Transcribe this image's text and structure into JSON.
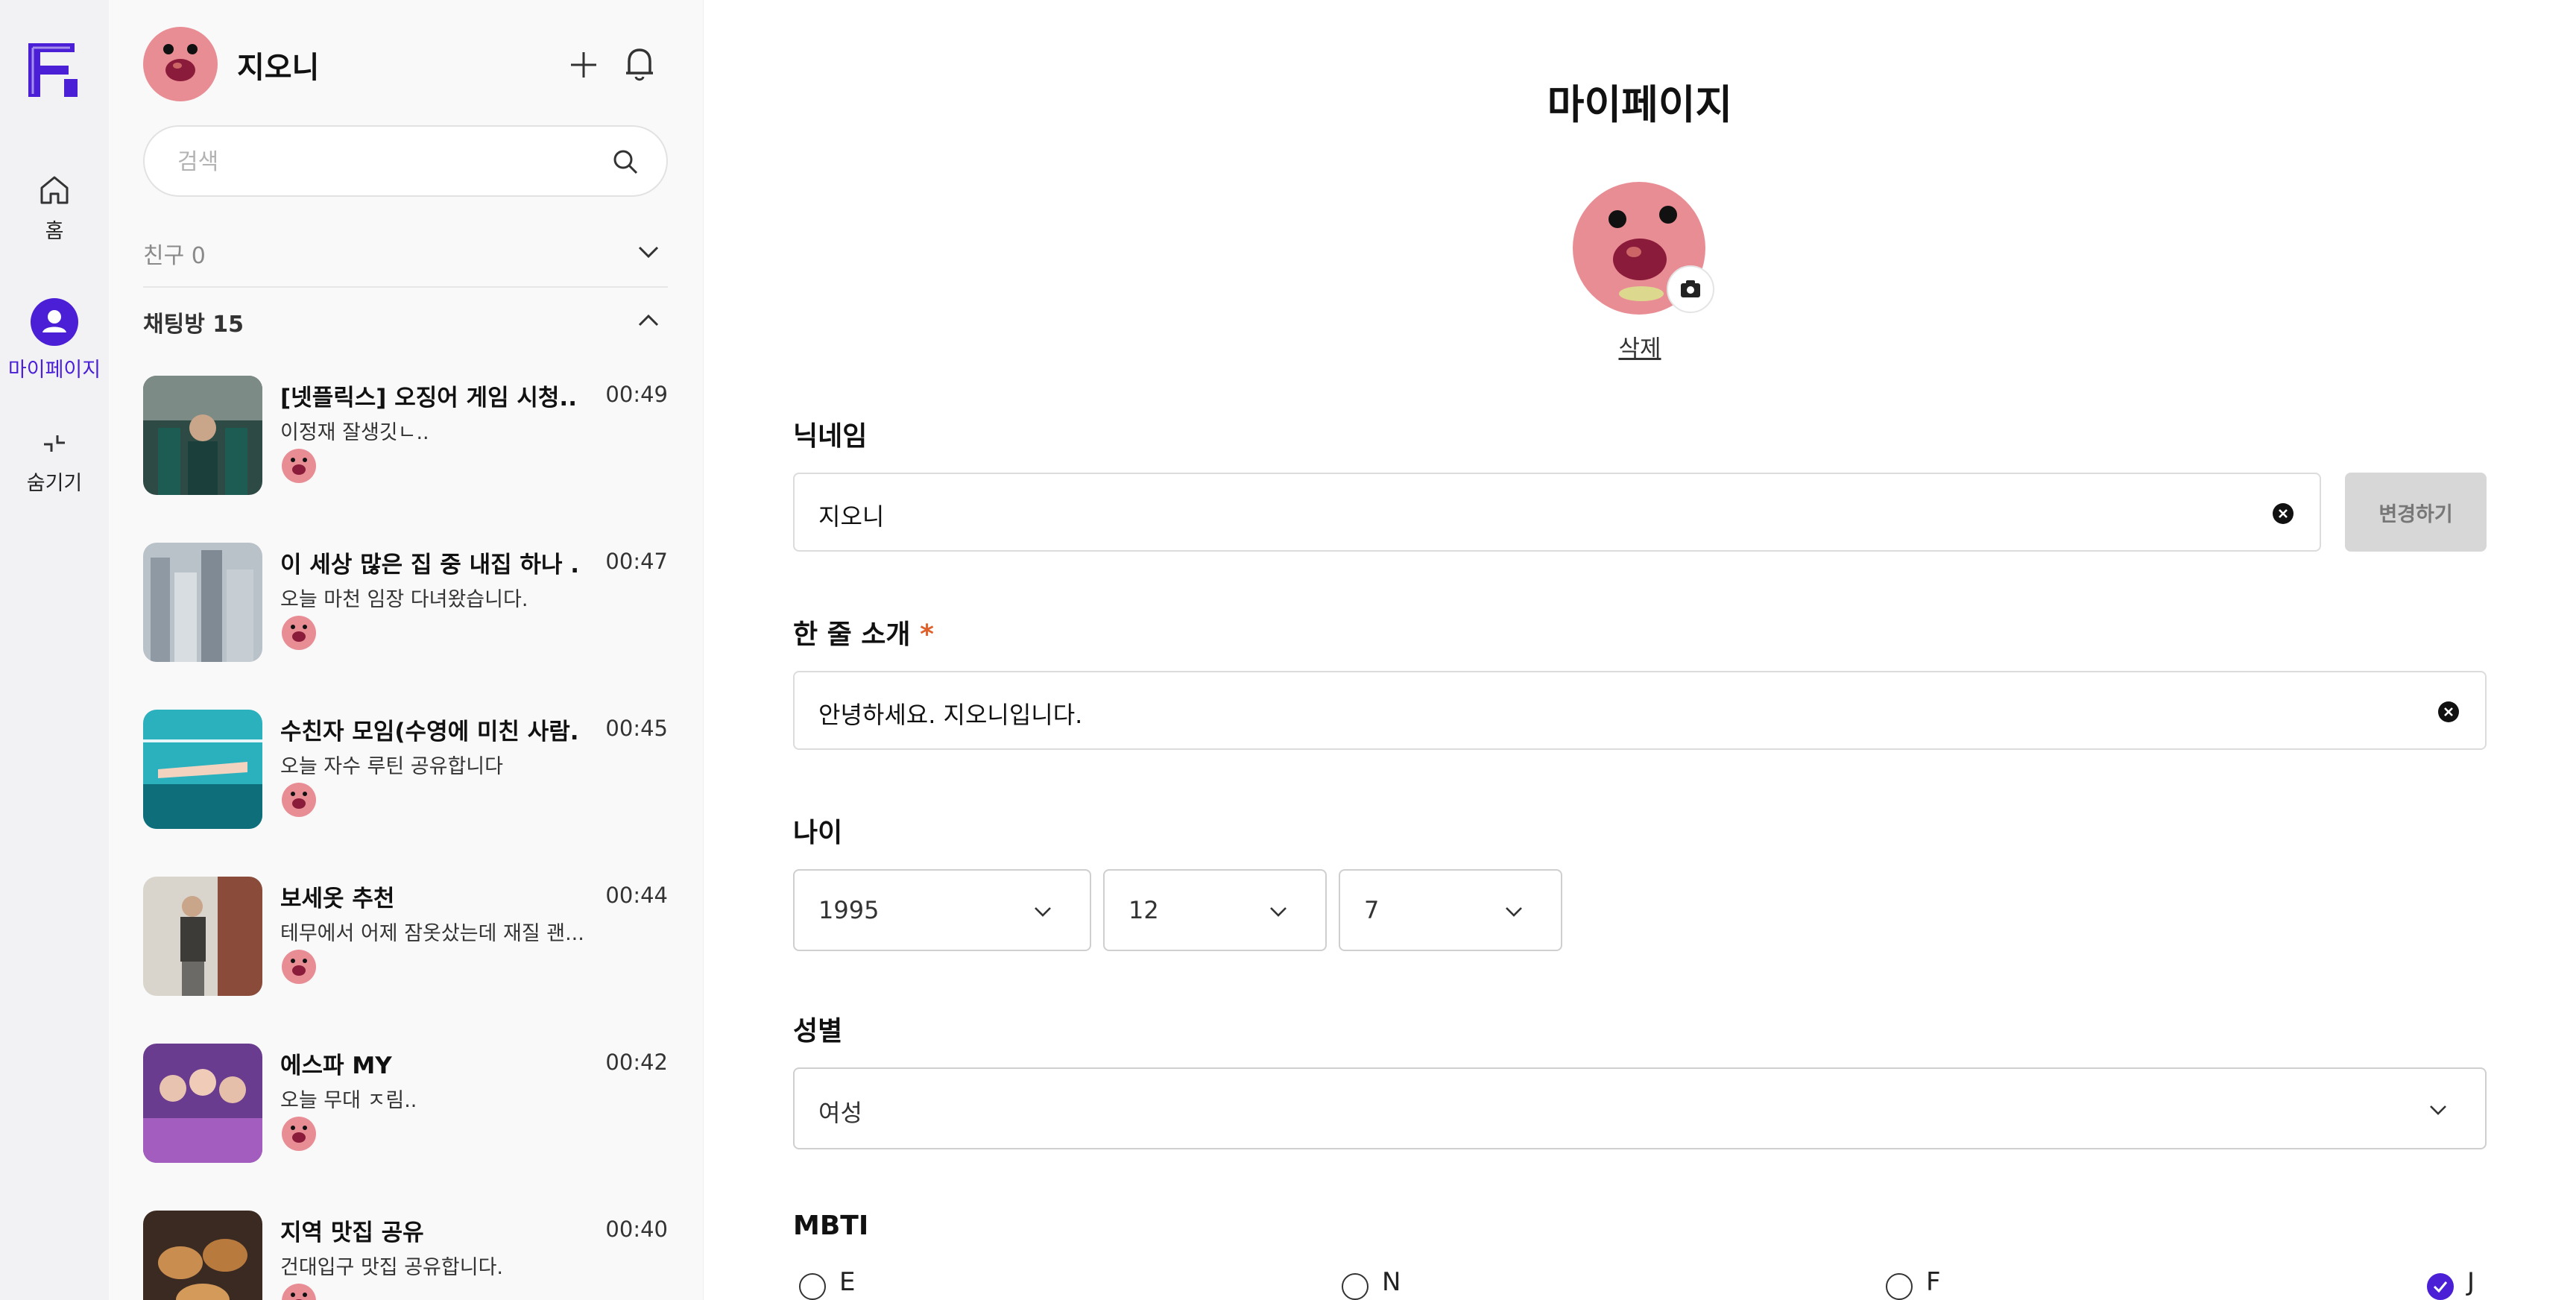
{
  "rail": {
    "items": [
      {
        "label": "홈",
        "icon": "home-icon"
      },
      {
        "label": "마이페이지",
        "icon": "user-icon",
        "active": true
      },
      {
        "label": "숨기기",
        "icon": "collapse-icon"
      }
    ]
  },
  "panel": {
    "user_name": "지오니",
    "search_placeholder": "검색",
    "friends_label": "친구 0",
    "rooms_label": "채팅방 15",
    "rooms": [
      {
        "title": "[넷플릭스] 오징어 게임 시청...",
        "time": "00:49",
        "message": "이정재 잘생깃ㄴ.."
      },
      {
        "title": "이 세상 많은 집 중 내집 하나 ...",
        "time": "00:47",
        "message": "오늘 마천 임장 다녀왔습니다."
      },
      {
        "title": "수친자 모임(수영에 미친 사람...",
        "time": "00:45",
        "message": "오늘 자수 루틴 공유합니다"
      },
      {
        "title": "보세옷 추천",
        "time": "00:44",
        "message": "테무에서 어제 잠옷샀는데 재질 괜..."
      },
      {
        "title": "에스파 MY",
        "time": "00:42",
        "message": "오늘 무대 ㅈ림.."
      },
      {
        "title": "지역 맛집 공유",
        "time": "00:40",
        "message": "건대입구 맛집 공유합니다."
      }
    ]
  },
  "main": {
    "title": "마이페이지",
    "delete_label": "삭제",
    "nickname_label": "닉네임",
    "nickname_value": "지오니",
    "change_button": "변경하기",
    "intro_label": "한 줄 소개",
    "intro_required": "*",
    "intro_value": "안녕하세요. 지오니입니다.",
    "age_label": "나이",
    "age_year": "1995",
    "age_month": "12",
    "age_day": "7",
    "gender_label": "성별",
    "gender_value": "여성",
    "mbti_label": "MBTI",
    "mbti_options": [
      {
        "label": "E",
        "checked": false
      },
      {
        "label": "N",
        "checked": false
      },
      {
        "label": "F",
        "checked": false
      },
      {
        "label": "J",
        "checked": true
      }
    ]
  },
  "colors": {
    "accent": "#4a1fd6",
    "rail_bg": "#f2f2f4",
    "panel_bg": "#f9f9f9",
    "required": "#e0602b"
  }
}
